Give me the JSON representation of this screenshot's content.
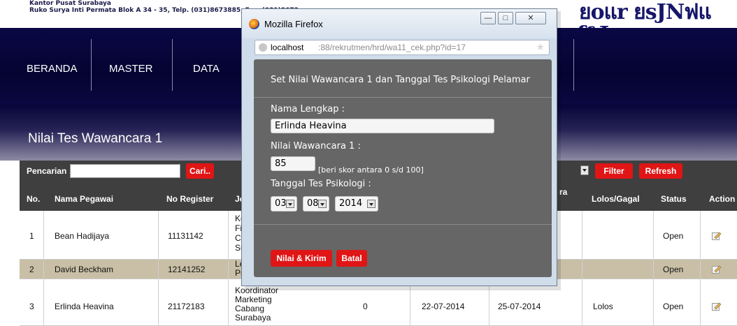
{
  "header": {
    "address_line1": "Kantor Pusat Surabaya",
    "address_line2": "Ruko Surya Inti Permata Blok A 34 - 35, Telp. (031)8673885, Fax. (031)8673",
    "brand_text": "ยoแr ยѕJNฟแ ʃƥJ"
  },
  "nav": {
    "items": [
      "BERANDA",
      "MASTER",
      "DATA"
    ]
  },
  "page": {
    "title": "Nilai Tes Wawancara 1"
  },
  "search": {
    "label": "Pencarian :",
    "value": "",
    "button": "Cari..",
    "filter_button": "Filter",
    "refresh_button": "Refresh"
  },
  "table": {
    "columns": {
      "no": "No.",
      "nama": "Nama Pegawai",
      "register": "No Register",
      "jabatan": "Je",
      "wawancara_tail": "ra",
      "lolos": "Lolos/Gagal",
      "status": "Status",
      "action": "Action"
    },
    "rows": [
      {
        "no": "1",
        "nama": "Bean Hadijaya",
        "register": "11131142",
        "jabatan": [
          "Ko",
          "Fin",
          "Ca",
          "Su"
        ],
        "nilai": "",
        "tgl1": "",
        "tgl2": "",
        "lolos": "",
        "status": "Open"
      },
      {
        "no": "2",
        "nama": "David Beckham",
        "register": "12141252",
        "jabatan": [
          "Le",
          "Pu"
        ],
        "nilai": "",
        "tgl1": "",
        "tgl2": "",
        "lolos": "",
        "status": "Open"
      },
      {
        "no": "3",
        "nama": "Erlinda Heavina",
        "register": "21172183",
        "jabatan": [
          "Koordinator",
          "Marketing",
          "Cabang",
          "Surabaya"
        ],
        "nilai": "0",
        "tgl1": "22-07-2014",
        "tgl2": "25-07-2014",
        "lolos": "Lolos",
        "status": "Open"
      }
    ]
  },
  "popup": {
    "window_title": "Mozilla Firefox",
    "url_host": "localhost",
    "url_rest": ":88/rekrutmen/hrd/wa11_cek.php?id=17",
    "heading": "Set Nilai Wawancara 1 dan Tanggal Tes Psikologi Pelamar",
    "nama_label": "Nama Lengkap :",
    "nama_value": "Erlinda Heavina",
    "nilai_label": "Nilai Wawancara 1 :",
    "nilai_value": "85",
    "nilai_hint": "[beri skor antara 0 s/d 100]",
    "tanggal_label": "Tanggal Tes Psikologi :",
    "day": "03",
    "month": "08",
    "year": "2014",
    "submit_button": "Nilai & Kirim",
    "cancel_button": "Batal",
    "minimize": "—",
    "maximize": "□",
    "close": "✕"
  },
  "colors": {
    "nav_bg": "#050331",
    "header_bar": "#3f3f3f",
    "accent_red": "#e01515",
    "row_highlight": "#c9bfa6",
    "dialog_bg": "#666666"
  }
}
